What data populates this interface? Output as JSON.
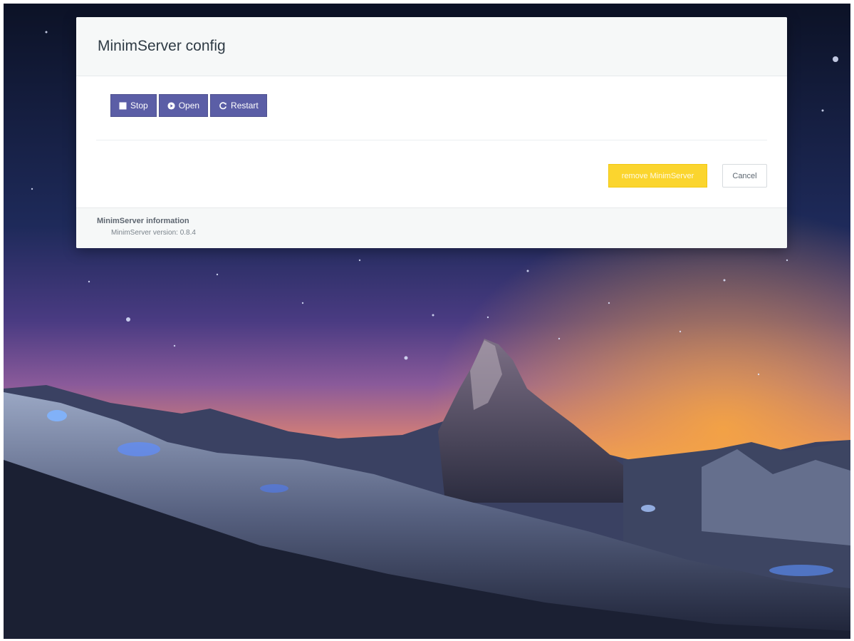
{
  "modal": {
    "title": "MinimServer config",
    "buttons": {
      "stop_label": "Stop",
      "open_label": "Open",
      "restart_label": "Restart",
      "remove_label": "remove MinimServer",
      "cancel_label": "Cancel"
    },
    "icons": {
      "stop": "stop-square-icon",
      "open": "play-circle-icon",
      "restart": "refresh-icon"
    },
    "info": {
      "title": "MinimServer information",
      "version_line": "MinimServer version: 0.8.4"
    }
  },
  "colors": {
    "primary_button": "#5b5ea6",
    "warning_button": "#fbd52e",
    "header_bg": "#f6f8f8"
  }
}
